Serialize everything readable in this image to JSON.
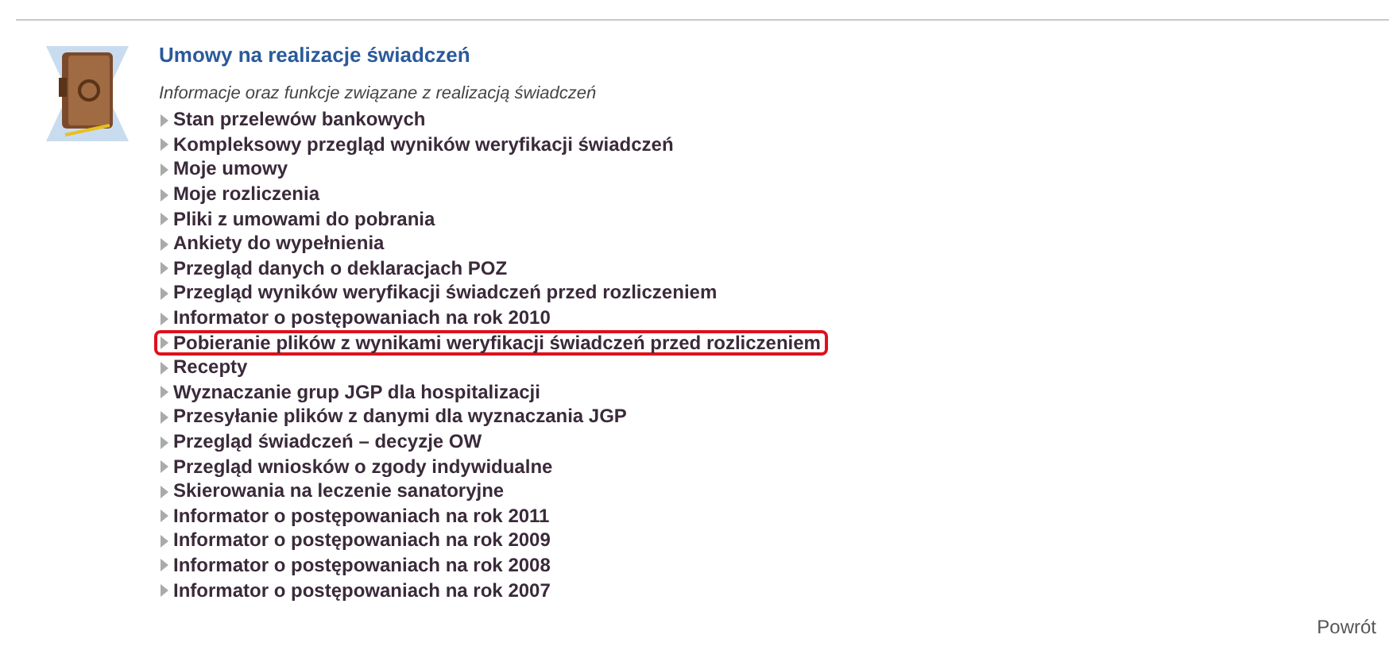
{
  "section": {
    "title": "Umowy na realizacje świadczeń",
    "subtitle": "Informacje oraz funkcje związane z realizacją świadczeń"
  },
  "links": [
    {
      "label": "Stan przelewów bankowych",
      "highlighted": false
    },
    {
      "label": "Kompleksowy przegląd wyników weryfikacji świadczeń",
      "highlighted": false
    },
    {
      "label": "Moje umowy",
      "highlighted": false
    },
    {
      "label": "Moje rozliczenia",
      "highlighted": false
    },
    {
      "label": "Pliki z umowami do pobrania",
      "highlighted": false
    },
    {
      "label": "Ankiety do wypełnienia",
      "highlighted": false
    },
    {
      "label": "Przegląd danych o deklaracjach POZ",
      "highlighted": false
    },
    {
      "label": "Przegląd wyników weryfikacji świadczeń przed rozliczeniem",
      "highlighted": false
    },
    {
      "label": "Informator o postępowaniach na rok 2010",
      "highlighted": false
    },
    {
      "label": "Pobieranie plików z wynikami weryfikacji świadczeń przed rozliczeniem",
      "highlighted": true
    },
    {
      "label": "Recepty",
      "highlighted": false
    },
    {
      "label": "Wyznaczanie grup JGP dla hospitalizacji",
      "highlighted": false
    },
    {
      "label": "Przesyłanie plików z danymi dla wyznaczania JGP",
      "highlighted": false
    },
    {
      "label": "Przegląd świadczeń – decyzje OW",
      "highlighted": false
    },
    {
      "label": "Przegląd wniosków o zgody indywidualne",
      "highlighted": false
    },
    {
      "label": "Skierowania na leczenie sanatoryjne",
      "highlighted": false
    },
    {
      "label": "Informator o postępowaniach na rok 2011",
      "highlighted": false
    },
    {
      "label": "Informator o postępowaniach na rok 2009",
      "highlighted": false
    },
    {
      "label": "Informator o postępowaniach na rok 2008",
      "highlighted": false
    },
    {
      "label": "Informator o postępowaniach na rok 2007",
      "highlighted": false
    }
  ],
  "back_link": "Powrót"
}
